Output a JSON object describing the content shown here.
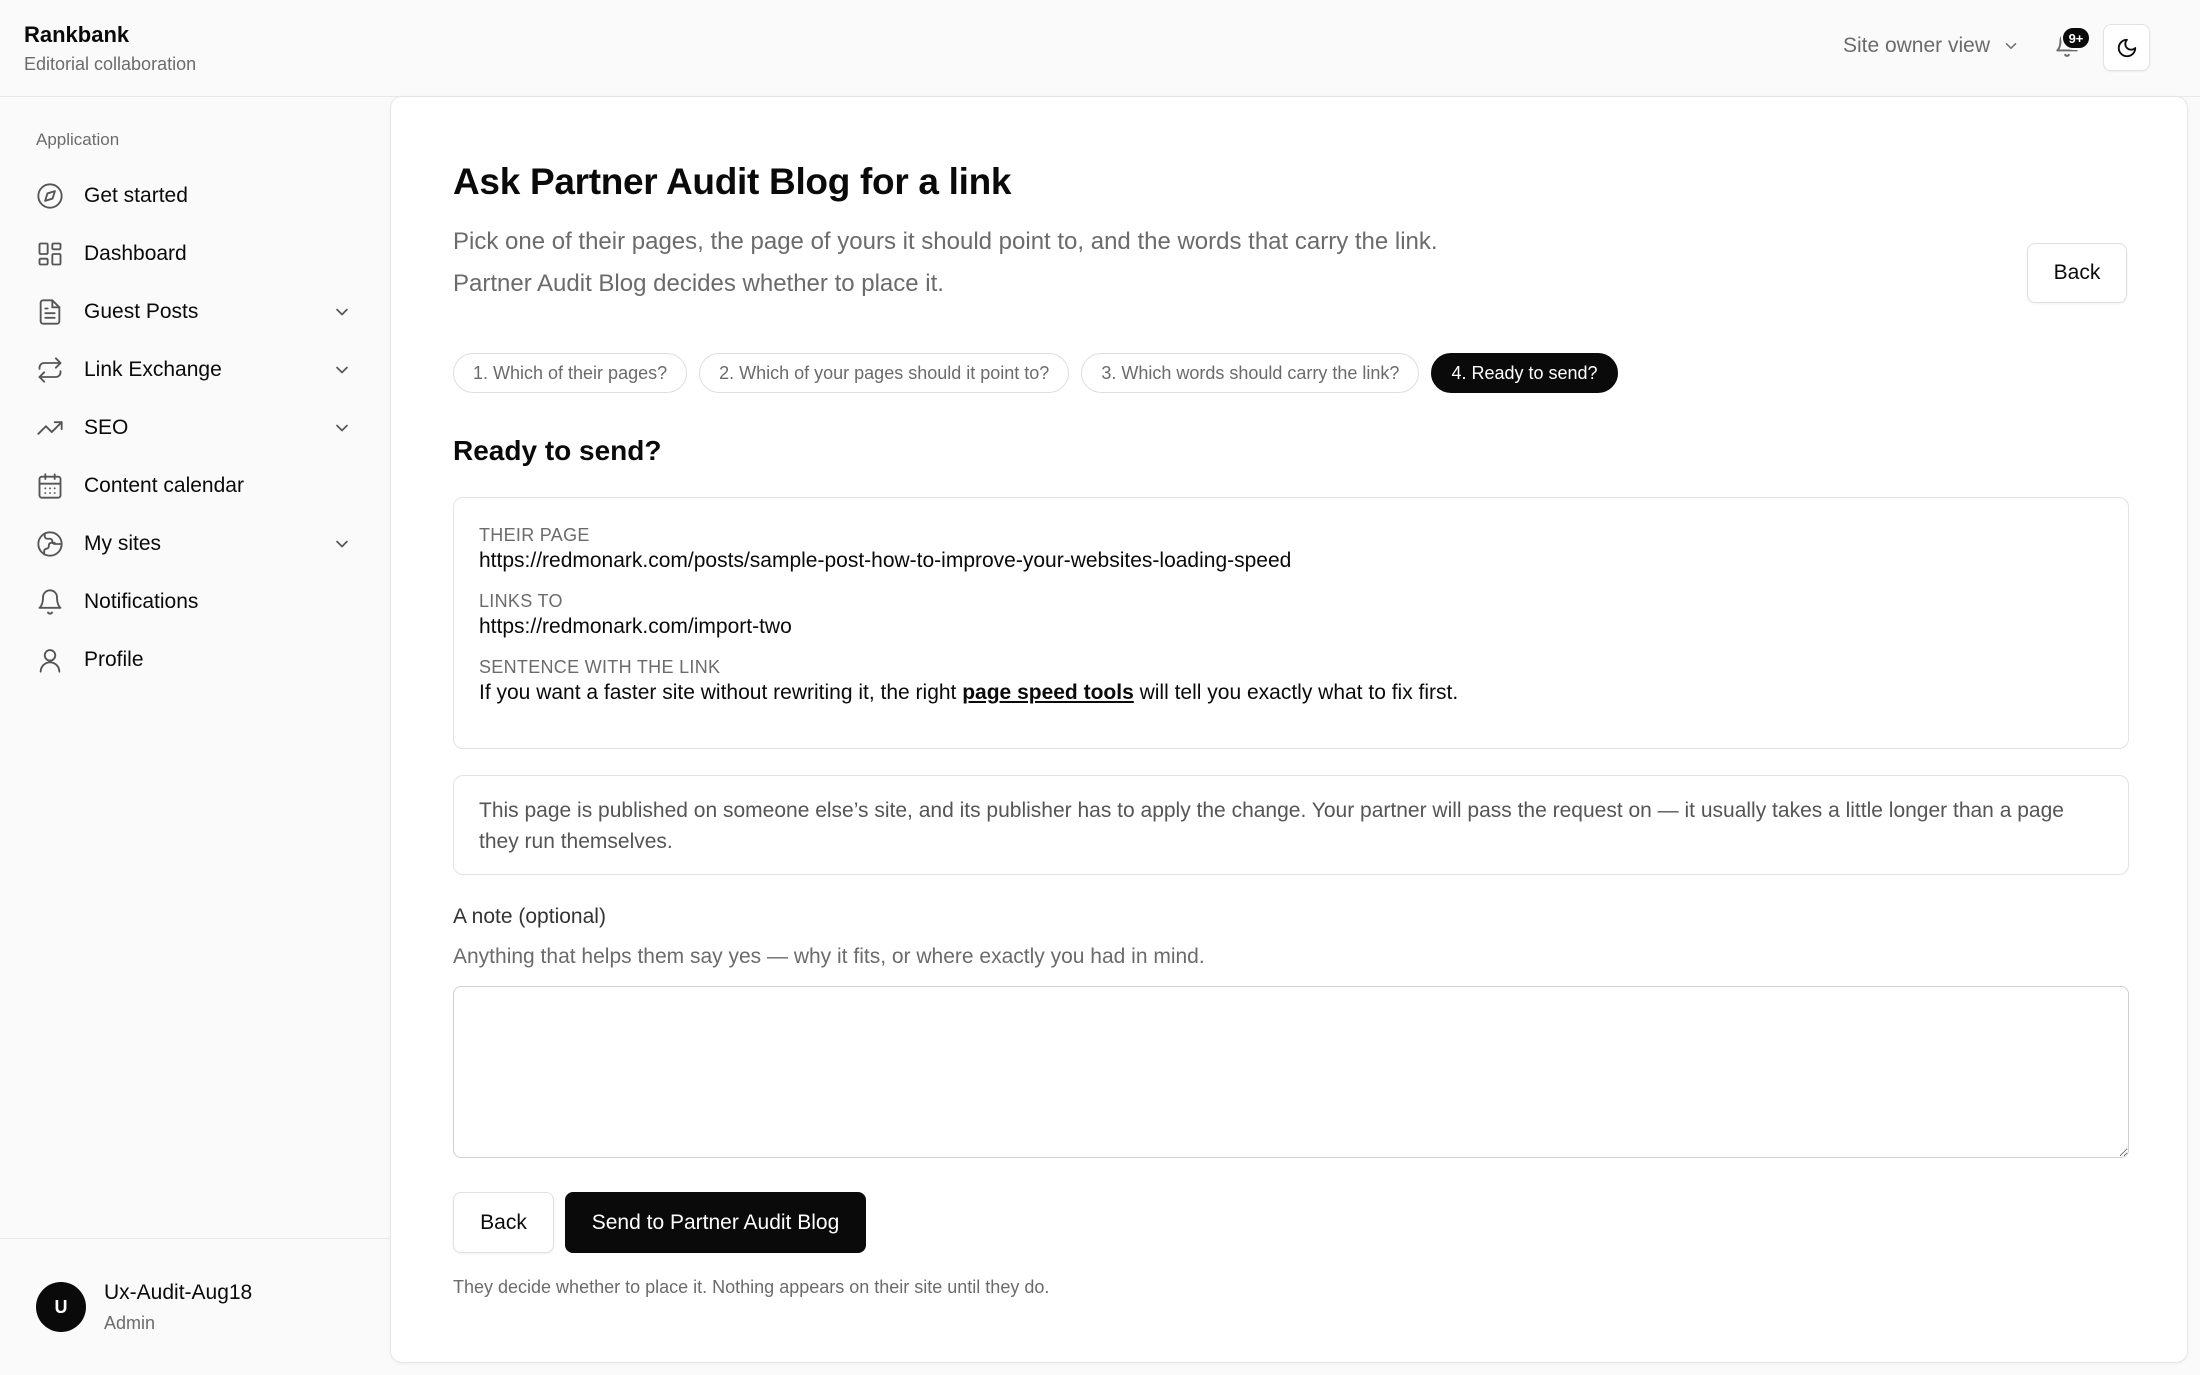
{
  "app": {
    "name": "Rankbank",
    "subtitle": "Editorial collaboration"
  },
  "topbar": {
    "view_label": "Site owner view",
    "notification_badge": "9+"
  },
  "sidebar": {
    "heading": "Application",
    "items": [
      {
        "label": "Get started",
        "icon": "compass-icon",
        "expandable": false
      },
      {
        "label": "Dashboard",
        "icon": "dashboard-grid-icon",
        "expandable": false
      },
      {
        "label": "Guest Posts",
        "icon": "document-icon",
        "expandable": true
      },
      {
        "label": "Link Exchange",
        "icon": "repeat-arrows-icon",
        "expandable": true
      },
      {
        "label": "SEO",
        "icon": "trending-up-icon",
        "expandable": true
      },
      {
        "label": "Content calendar",
        "icon": "calendar-icon",
        "expandable": false
      },
      {
        "label": "My sites",
        "icon": "globe-icon",
        "expandable": true
      },
      {
        "label": "Notifications",
        "icon": "bell-icon",
        "expandable": false
      },
      {
        "label": "Profile",
        "icon": "user-icon",
        "expandable": false
      }
    ],
    "user": {
      "initial": "U",
      "name": "Ux-Audit-Aug18",
      "role": "Admin"
    }
  },
  "main": {
    "title": "Ask Partner Audit Blog for a link",
    "description_line1": "Pick one of their pages, the page of yours it should point to, and the words that carry the link.",
    "description_line2": "Partner Audit Blog decides whether to place it.",
    "back_label": "Back",
    "steps": [
      {
        "label": "1. Which of their pages?",
        "active": false
      },
      {
        "label": "2. Which of your pages should it point to?",
        "active": false
      },
      {
        "label": "3. Which words should carry the link?",
        "active": false
      },
      {
        "label": "4. Ready to send?",
        "active": true
      }
    ],
    "section_title": "Ready to send?",
    "summary": {
      "their_page_label": "THEIR PAGE",
      "their_page_value": "https://redmonark.com/posts/sample-post-how-to-improve-your-websites-loading-speed",
      "links_to_label": "LINKS TO",
      "links_to_value": "https://redmonark.com/import-two",
      "sentence_label": "SENTENCE WITH THE LINK",
      "sentence_before": "If you want a faster site without rewriting it, the right ",
      "sentence_anchor": "page speed tools",
      "sentence_after": " will tell you exactly what to fix first."
    },
    "notice": "This page is published on someone else’s site, and its publisher has to apply the change. Your partner will pass the request on — it usually takes a little longer than a page they run themselves.",
    "note": {
      "label": "A note (optional)",
      "help": "Anything that helps them say yes — why it fits, or where exactly you had in mind.",
      "value": ""
    },
    "actions": {
      "back_label": "Back",
      "send_label": "Send to Partner Audit Blog"
    },
    "footnote": "They decide whether to place it. Nothing appears on their site until they do."
  }
}
